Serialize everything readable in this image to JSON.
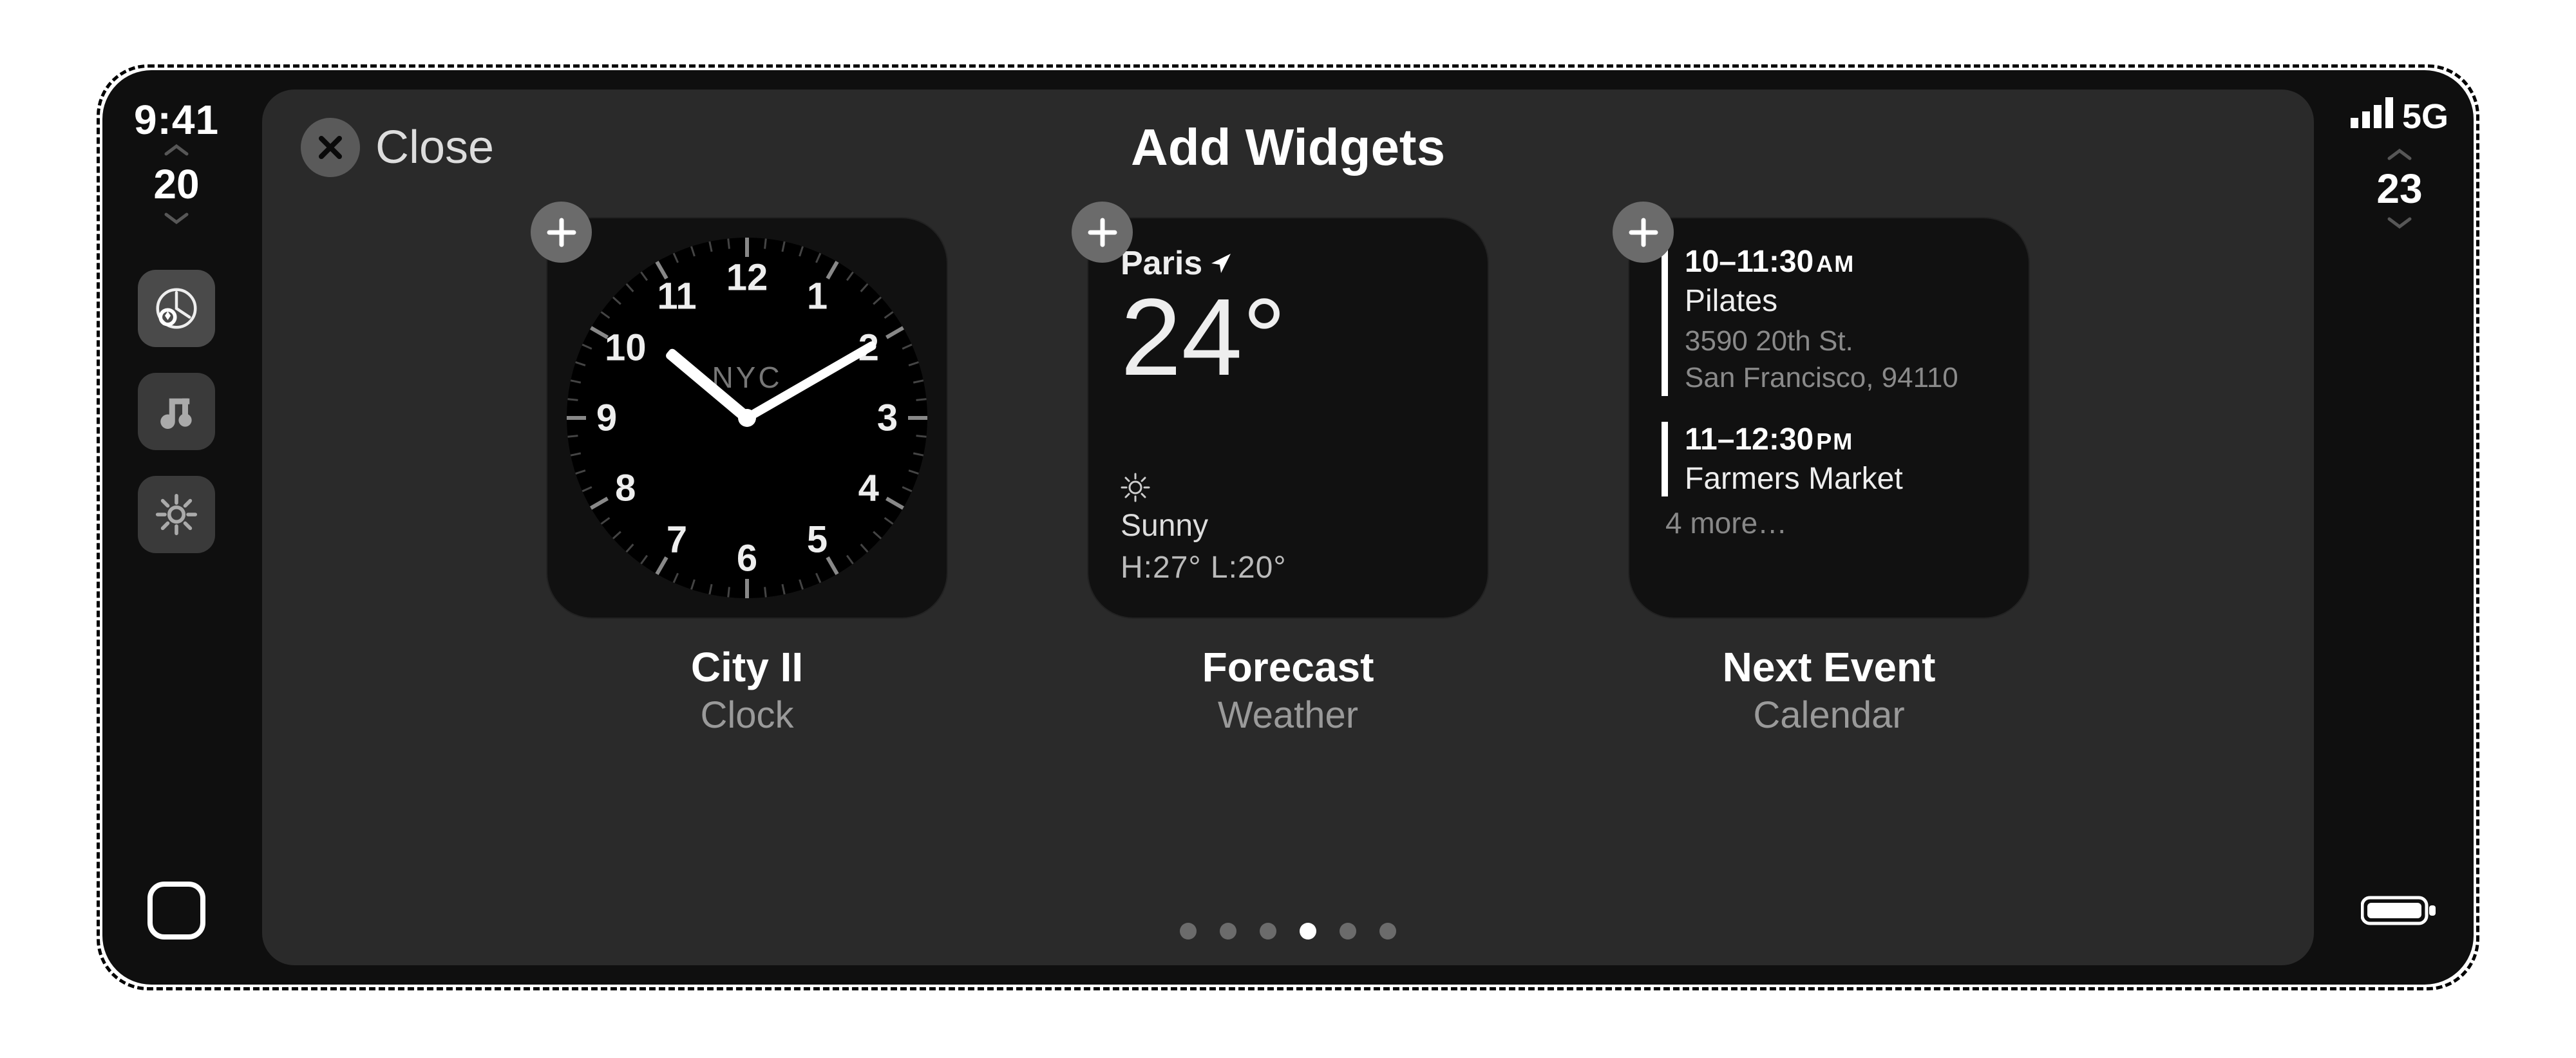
{
  "status_left": {
    "time": "9:41",
    "page": "20"
  },
  "status_right": {
    "net_label": "5G",
    "page": "23"
  },
  "header": {
    "close_label": "Close",
    "title": "Add Widgets"
  },
  "pager": {
    "count": 6,
    "active_index": 3
  },
  "widgets": [
    {
      "kind": "clock",
      "name": "City II",
      "app": "Clock",
      "clock": {
        "city": "NYC",
        "hour_angle": 310,
        "minute_angle": 60
      }
    },
    {
      "kind": "weather",
      "name": "Forecast",
      "app": "Weather",
      "weather": {
        "city": "Paris",
        "temp": "24°",
        "condition": "Sunny",
        "hi_lo": "H:27°  L:20°"
      }
    },
    {
      "kind": "calendar",
      "name": "Next Event",
      "app": "Calendar",
      "calendar": {
        "events": [
          {
            "time": "10–11:30",
            "ampm": "AM",
            "title": "Pilates",
            "loc1": "3590 20th St.",
            "loc2": "San Francisco, 94110"
          },
          {
            "time": "11–12:30",
            "ampm": "PM",
            "title": "Farmers Market",
            "loc1": "",
            "loc2": ""
          }
        ],
        "more": "4 more…"
      }
    }
  ]
}
